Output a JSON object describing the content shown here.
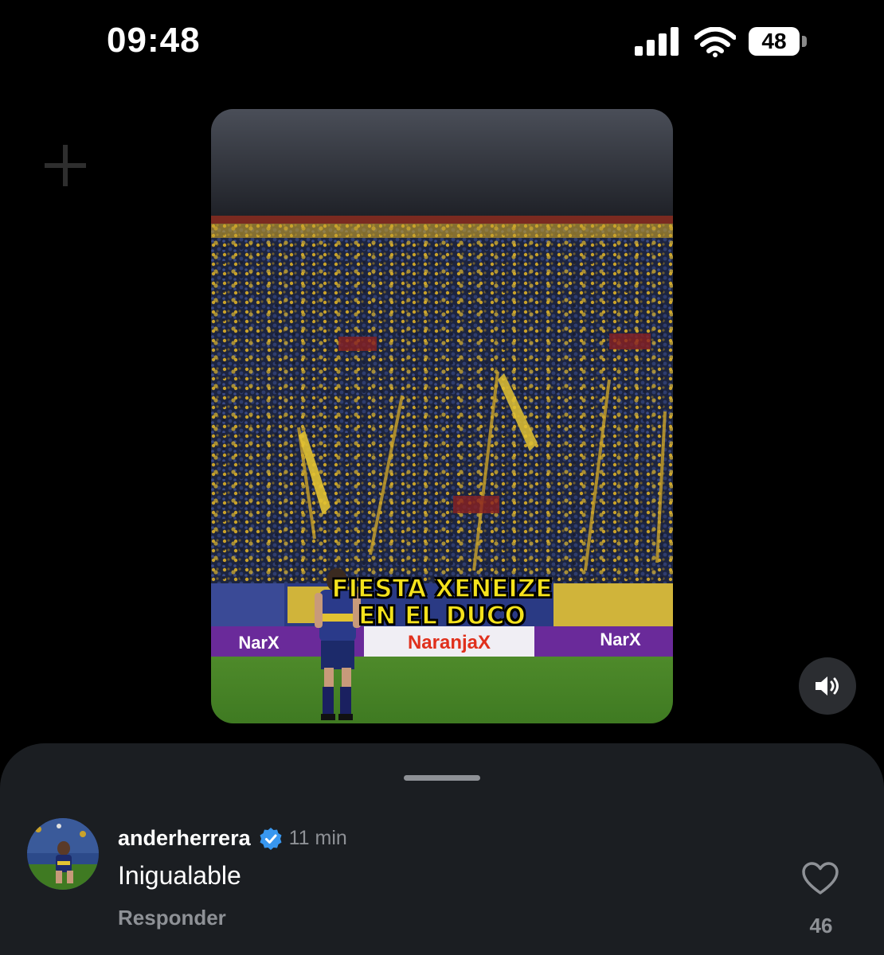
{
  "status_bar": {
    "time": "09:48",
    "battery": "48",
    "icons": [
      "cellular-signal-icon",
      "wifi-icon",
      "battery-icon"
    ]
  },
  "video": {
    "caption_line1": "FIESTA XENEIZE",
    "caption_line2": "EN EL DUCO",
    "signage": [
      "NarX",
      "NaranjaX",
      "NarX"
    ],
    "sound_icon": "speaker-on-icon"
  },
  "comment": {
    "username": "anderherrera",
    "verified": true,
    "time": "11 min",
    "text": "Inigualable",
    "reply_label": "Responder",
    "likes": "46"
  },
  "colors": {
    "sheet_background": "#1b1e22",
    "secondary_text": "#8e9196",
    "verified_blue": "#3897f0",
    "caption_yellow": "#f4e21c"
  }
}
